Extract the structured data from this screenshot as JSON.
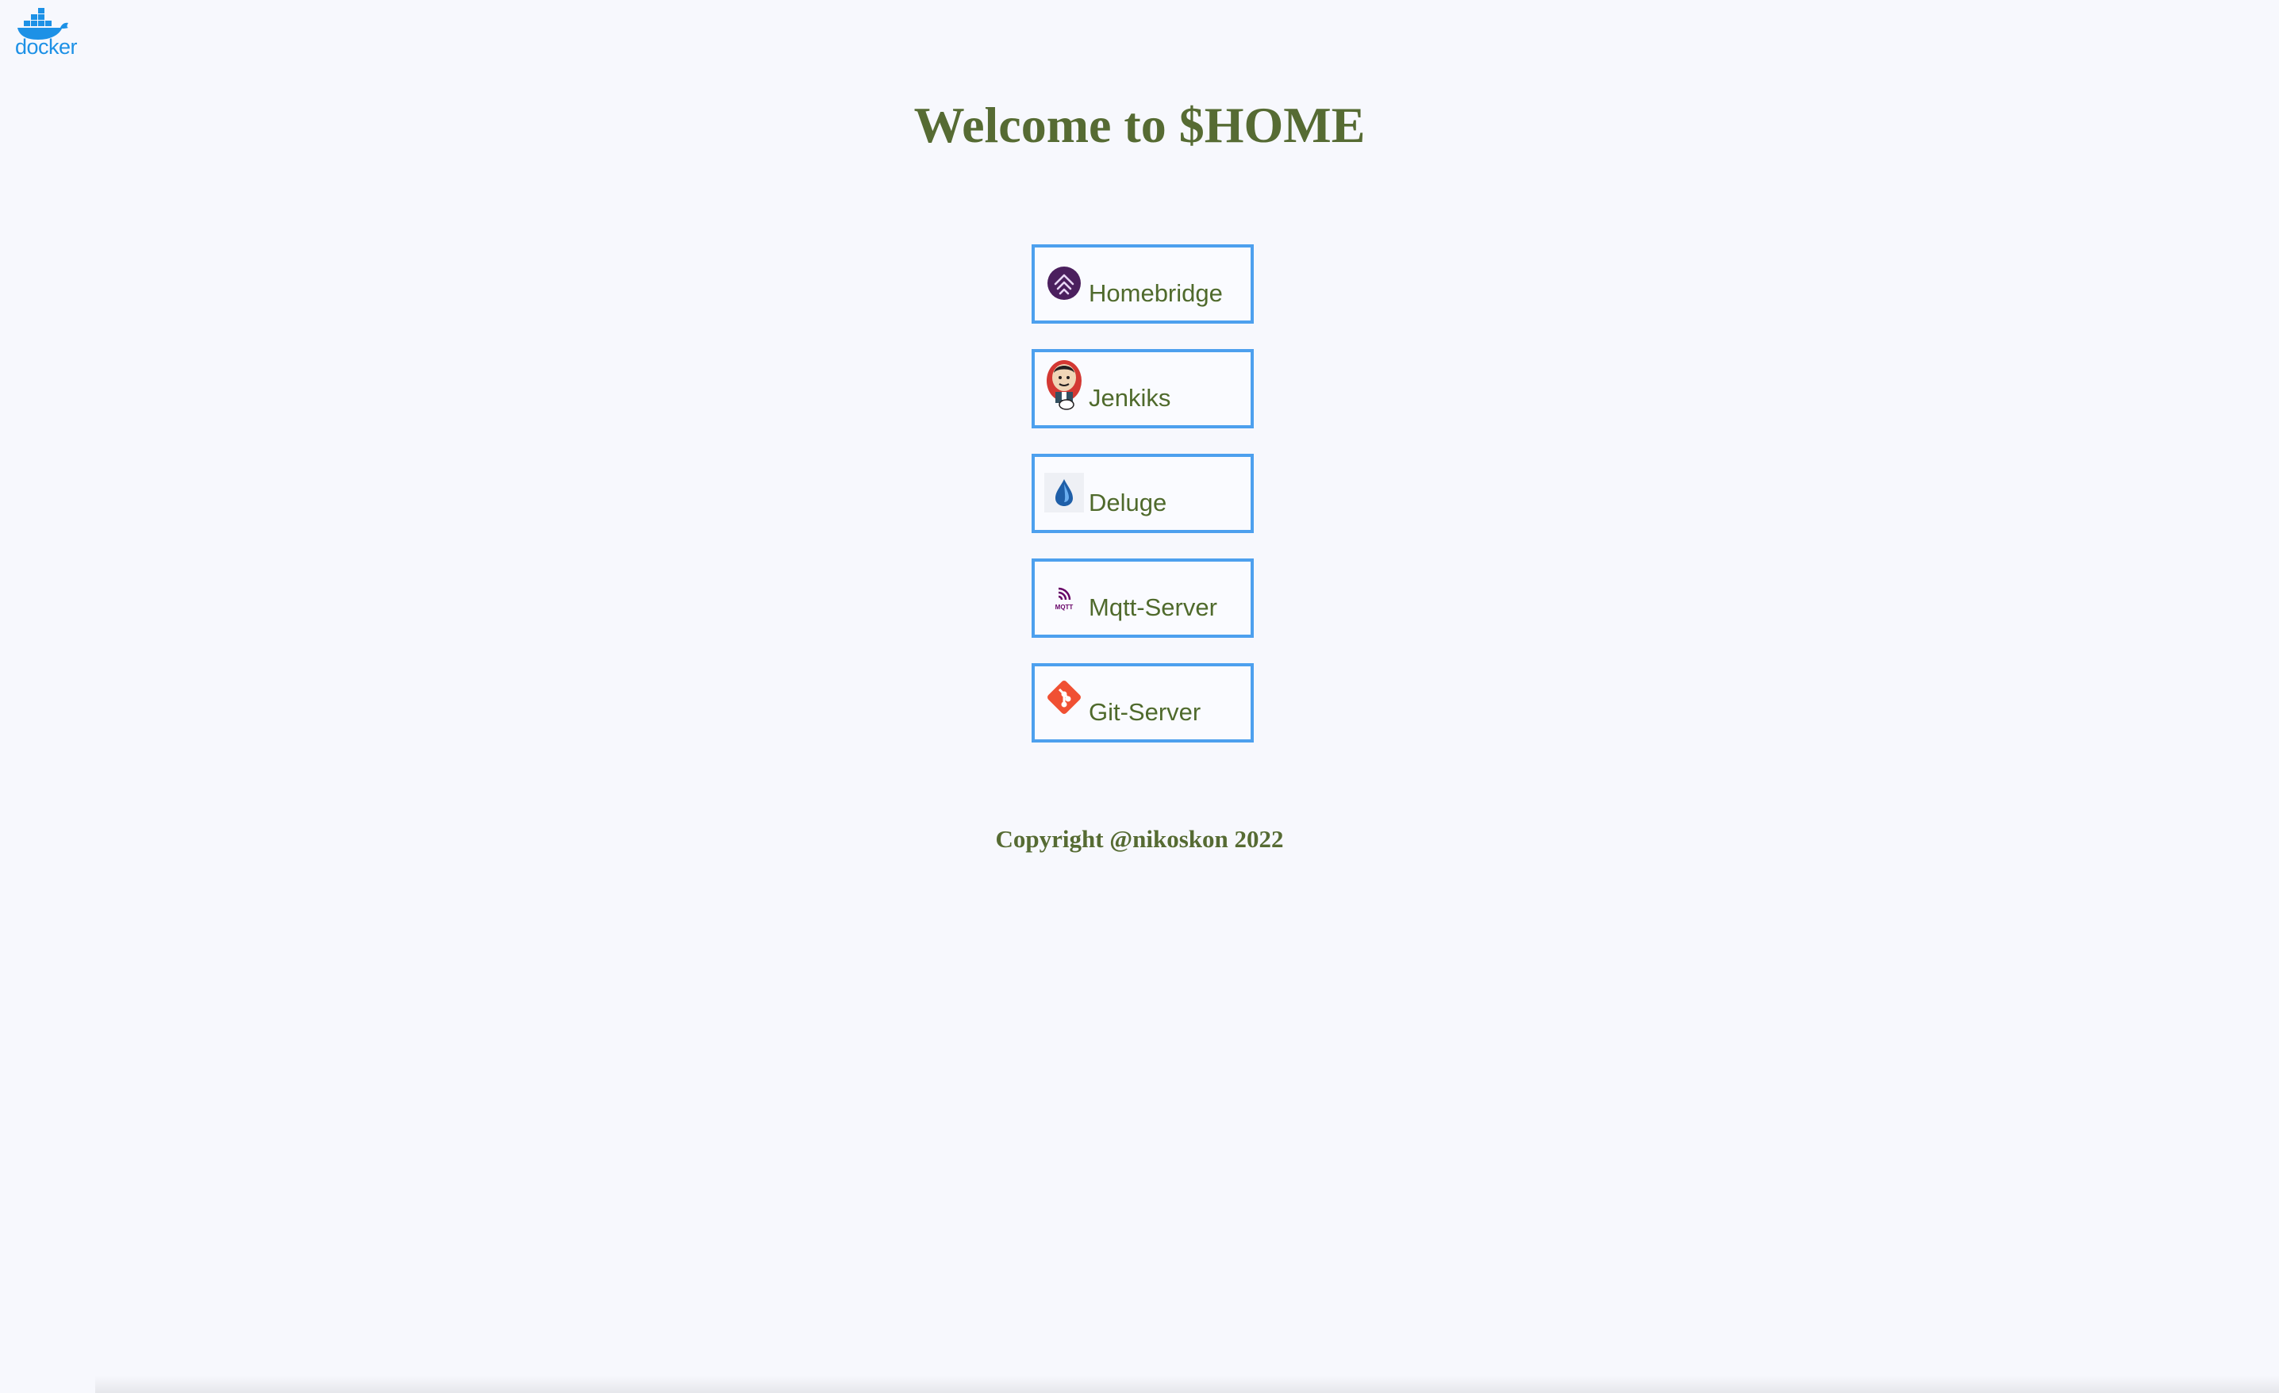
{
  "logo": {
    "icon": "docker-whale-icon",
    "text": "docker",
    "color": "#1d91e6"
  },
  "page_title": "Welcome to $HOME",
  "apps": [
    {
      "label": "Homebridge",
      "icon": "homebridge-icon"
    },
    {
      "label": "Jenkiks",
      "icon": "jenkins-icon"
    },
    {
      "label": "Deluge",
      "icon": "deluge-icon"
    },
    {
      "label": "Mqtt-Server",
      "icon": "mqtt-icon"
    },
    {
      "label": "Git-Server",
      "icon": "git-icon"
    }
  ],
  "footer": "Copyright @nikoskon 2022",
  "colors": {
    "background": "#f7f8fd",
    "text": "#566b33",
    "button_border": "#4da0ee"
  }
}
